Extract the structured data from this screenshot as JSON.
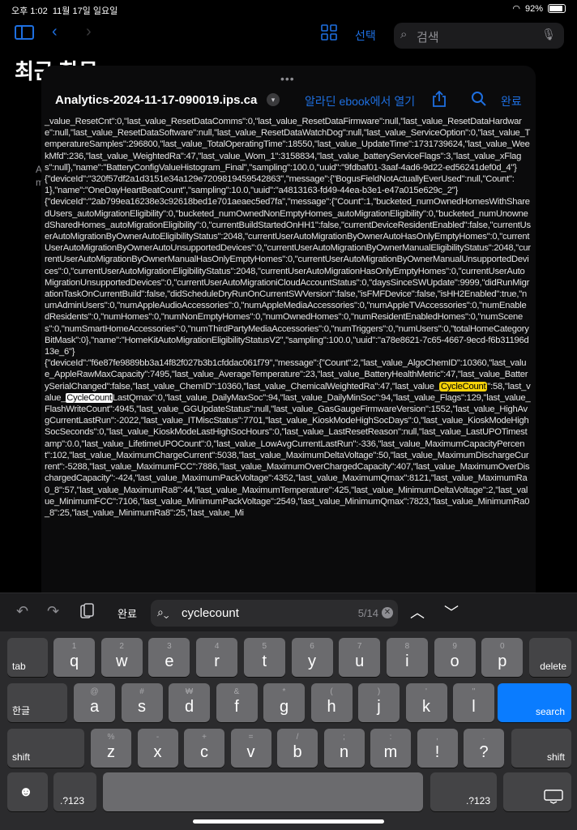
{
  "status": {
    "time": "오후 1:02",
    "date": "11월 17일 일요일",
    "battery": "92%"
  },
  "appnav": {
    "select": "선택",
    "search_placeholder": "검색"
  },
  "background": {
    "title": "최근 항목",
    "side_a": "A",
    "side_m": "m"
  },
  "sheet": {
    "title": "Analytics-2024-11-17-090019.ips.ca",
    "open_in": "알라딘 ebook에서 열기",
    "done": "완료"
  },
  "log": {
    "part1": "_value_ResetCnt\":0,\"last_value_ResetDataComms\":0,\"last_value_ResetDataFirmware\":null,\"last_value_ResetDataHardware\":null,\"last_value_ResetDataSoftware\":null,\"last_value_ResetDataWatchDog\":null,\"last_value_ServiceOption\":0,\"last_value_TemperatureSamples\":296800,\"last_value_TotalOperatingTime\":18550,\"last_value_UpdateTime\":1731739624,\"last_value_WeekMfd\":236,\"last_value_WeightedRa\":47,\"last_value_Wom_1\":3158834,\"last_value_batteryServiceFlags\":3,\"last_value_xFlags\":null},\"name\":\"BatteryConfigValueHistogram_Final\",\"sampling\":100.0,\"uuid\":\"9fdbaf01-3aaf-4ad6-9d22-ed56241def0d_4\"}\n{\"deviceId\":\"320f57df2a1d3151e34a129e7209819459542863\",\"message\":{\"BogusFieldNotActuallyEverUsed\":null,\"Count\":1},\"name\":\"OneDayHeartBeatCount\",\"sampling\":10.0,\"uuid\":\"a4813163-fd49-44ea-b3e1-e47a015e629c_2\"}\n{\"deviceId\":\"2ab799ea16238e3c92618bed1e701aeaec5ed7fa\",\"message\":{\"Count\":1,\"bucketed_numOwnedHomesWithSharedUsers_autoMigrationEligibility\":0,\"bucketed_numOwnedNonEmptyHomes_autoMigrationEligibility\":0,\"bucketed_numUnownedSharedHomes_autoMigrationEligibility\":0,\"currentBuildStartedOnHH1\":false,\"currentDeviceResidentEnabled\":false,\"currentUserAutoMigrationByOwnerAutoEligibilityStatus\":2048,\"currentUserAutoMigrationByOwnerAutoHasOnlyEmptyHomes\":0,\"currentUserAutoMigrationByOwnerAutoUnsupportedDevices\":0,\"currentUserAutoMigrationByOwnerManualEligibilityStatus\":2048,\"currentUserAutoMigrationByOwnerManualHasOnlyEmptyHomes\":0,\"currentUserAutoMigrationByOwnerManualUnsupportedDevices\":0,\"currentUserAutoMigrationEligibilityStatus\":2048,\"currentUserAutoMigrationHasOnlyEmptyHomes\":0,\"currentUserAutoMigrationUnsupportedDevices\":0,\"currentUserAutoMigrationiCloudAccountStatus\":0,\"daysSinceSWUpdate\":9999,\"didRunMigrationTaskOnCurrentBuild\":false,\"didScheduleDryRunOnCurrentSWVersion\":false,\"isFMFDevice\":false,\"isHH2Enabled\":true,\"numAdminUsers\":0,\"numAppleAudioAccessories\":0,\"numAppleMediaAccessories\":0,\"numAppleTVAccessories\":0,\"numEnabledResidents\":0,\"numHomes\":0,\"numNonEmptyHomes\":0,\"numOwnedHomes\":0,\"numResidentEnabledHomes\":0,\"numScenes\":0,\"numSmartHomeAccessories\":0,\"numThirdPartyMediaAccessories\":0,\"numTriggers\":0,\"numUsers\":0,\"totalHomeCategoryBitMask\":0},\"name\":\"HomeKitAutoMigrationEligibilityStatusV2\",\"sampling\":100.0,\"uuid\":\"a78e8621-7c65-4667-9ecd-f6b31196d13e_6\"}\n{\"deviceId\":\"f6e87fe9889bb3a14f82f027b3b1cfddac061f79\",\"message\":{\"Count\":2,\"last_value_AlgoChemID\":10360,\"last_value_AppleRawMaxCapacity\":7495,\"last_value_AverageTemperature\":23,\"last_value_BatteryHealthMetric\":47,\"last_value_BatterySerialChanged\":false,\"last_value_ChemID\":10360,\"last_value_ChemicalWeightedRa\":47,\"last_value_",
    "hl1": "CycleCount",
    "part2": "\":58,\"last_value_",
    "hl2": "CycleCount",
    "part3": "LastQmax\":0,\"last_value_DailyMaxSoc\":94,\"last_value_DailyMinSoc\":94,\"last_value_Flags\":129,\"last_value_FlashWriteCount\":4945,\"last_value_GGUpdateStatus\":null,\"last_value_GasGaugeFirmwareVersion\":1552,\"last_value_HighAvgCurrentLastRun\":-2022,\"last_value_ITMiscStatus\":7701,\"last_value_KioskModeHighSocDays\":0,\"last_value_KioskModeHighSocSeconds\":0,\"last_value_KioskModeLastHighSocHours\":0,\"last_value_LastResetReason\":null,\"last_value_LastUPOTimestamp\":0.0,\"last_value_LifetimeUPOCount\":0,\"last_value_LowAvgCurrentLastRun\":-336,\"last_value_MaximumCapacityPercent\":102,\"last_value_MaximumChargeCurrent\":5038,\"last_value_MaximumDeltaVoltage\":50,\"last_value_MaximumDischargeCurrent\":-5288,\"last_value_MaximumFCC\":7886,\"last_value_MaximumOverChargedCapacity\":407,\"last_value_MaximumOverDischargedCapacity\":-424,\"last_value_MaximumPackVoltage\":4352,\"last_value_MaximumQmax\":8121,\"last_value_MaximumRa0_8\":57,\"last_value_MaximumRa8\":44,\"last_value_MaximumTemperature\":425,\"last_value_MinimumDeltaVoltage\":2,\"last_value_MinimumFCC\":7106,\"last_value_MinimumPackVoltage\":2549,\"last_value_MinimumQmax\":7823,\"last_value_MinimumRa0_8\":25,\"last_value_MinimumRa8\":25,\"last_value_Mi"
  },
  "findbar": {
    "done": "완료",
    "query": "cyclecount",
    "count": "5/14"
  },
  "keyboard": {
    "row1": [
      {
        "sub": "1",
        "main": "q"
      },
      {
        "sub": "2",
        "main": "w"
      },
      {
        "sub": "3",
        "main": "e"
      },
      {
        "sub": "4",
        "main": "r"
      },
      {
        "sub": "5",
        "main": "t"
      },
      {
        "sub": "6",
        "main": "y"
      },
      {
        "sub": "7",
        "main": "u"
      },
      {
        "sub": "8",
        "main": "i"
      },
      {
        "sub": "9",
        "main": "o"
      },
      {
        "sub": "0",
        "main": "p"
      }
    ],
    "row2": [
      {
        "sub": "@",
        "main": "a"
      },
      {
        "sub": "#",
        "main": "s"
      },
      {
        "sub": "₩",
        "main": "d"
      },
      {
        "sub": "&",
        "main": "f"
      },
      {
        "sub": "*",
        "main": "g"
      },
      {
        "sub": "(",
        "main": "h"
      },
      {
        "sub": ")",
        "main": "j"
      },
      {
        "sub": "'",
        "main": "k"
      },
      {
        "sub": "\"",
        "main": "l"
      }
    ],
    "row3": [
      {
        "sub": "%",
        "main": "z"
      },
      {
        "sub": "-",
        "main": "x"
      },
      {
        "sub": "+",
        "main": "c"
      },
      {
        "sub": "=",
        "main": "v"
      },
      {
        "sub": "/",
        "main": "b"
      },
      {
        "sub": ";",
        "main": "n"
      },
      {
        "sub": ":",
        "main": "m"
      },
      {
        "sub": ",",
        "main": "!"
      },
      {
        "sub": ".",
        "main": "?"
      }
    ],
    "tab": "tab",
    "delete": "delete",
    "lang": "한글",
    "search": "search",
    "shift": "shift",
    "numbers": ".?123"
  }
}
